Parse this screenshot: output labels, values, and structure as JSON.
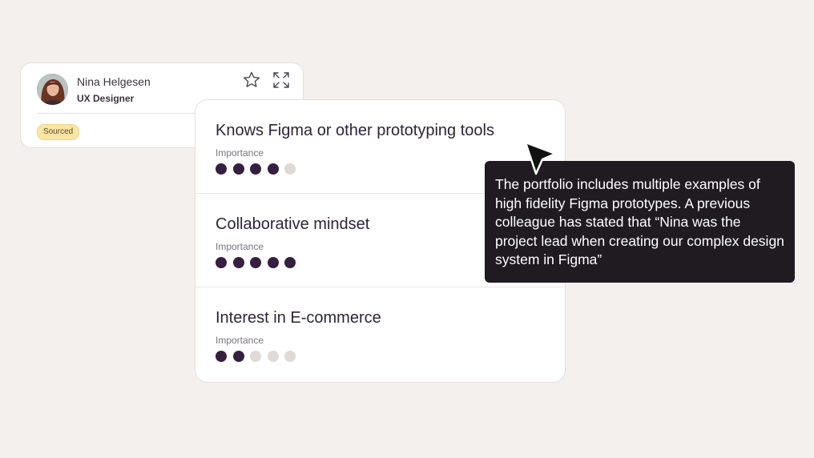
{
  "candidate": {
    "name": "Nina Helgesen",
    "role": "UX Designer",
    "status": "Sourced",
    "icons": [
      "star-icon",
      "expand-icon"
    ]
  },
  "requirements": [
    {
      "title": "Knows Figma or other prototyping tools",
      "importance_label": "Importance",
      "importance": 4,
      "max": 5
    },
    {
      "title": "Collaborative mindset",
      "importance_label": "Importance",
      "importance": 5,
      "max": 5
    },
    {
      "title": "Interest in E-commerce",
      "importance_label": "Importance",
      "importance": 2,
      "max": 5
    }
  ],
  "tooltip": {
    "text": "The portfolio includes multiple examples of high fidelity Figma prototypes. A previous colleague has stated that “Nina was the project lead when creating our complex design system in Figma”"
  },
  "colors": {
    "background": "#f4f0ee",
    "dot_filled": "#35203f",
    "dot_empty": "#dedad8",
    "badge_bg": "#fbe5a2",
    "tooltip_bg": "#1f1b21"
  }
}
